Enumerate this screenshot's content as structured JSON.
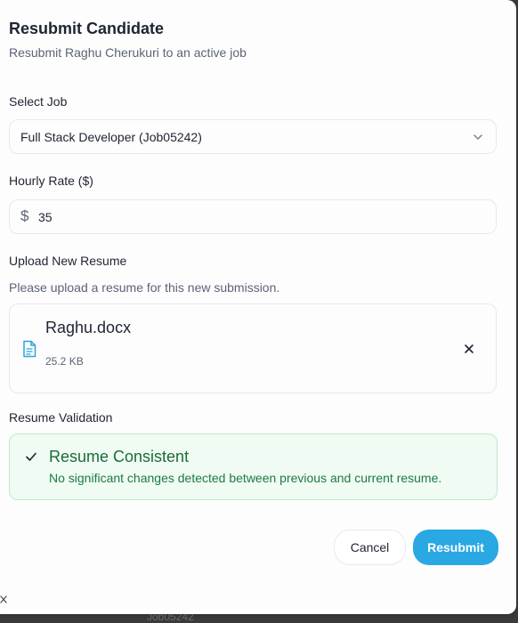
{
  "dialog": {
    "title": "Resubmit Candidate",
    "subtitle": "Resubmit Raghu Cherukuri to an active job"
  },
  "select_job": {
    "label": "Select Job",
    "value": "Full Stack Developer (Job05242)",
    "icon": "chevron-down-icon"
  },
  "hourly_rate": {
    "label": "Hourly Rate ($)",
    "currency_symbol": "$",
    "value": "35"
  },
  "upload": {
    "label": "Upload New Resume",
    "hint": "Please upload a resume for this new submission.",
    "file_name": "Raghu.docx",
    "file_size": "25.2 KB",
    "file_icon": "document-icon",
    "remove_icon": "close-icon"
  },
  "validation": {
    "label": "Resume Validation",
    "status_title": "Resume Consistent",
    "status_desc": "No significant changes detected between previous and current resume.",
    "icon": "check-icon",
    "color": "#1c6b3b"
  },
  "actions": {
    "cancel_label": "Cancel",
    "resubmit_label": "Resubmit",
    "accent": "#29a8e3"
  },
  "background_text": "Job05242"
}
